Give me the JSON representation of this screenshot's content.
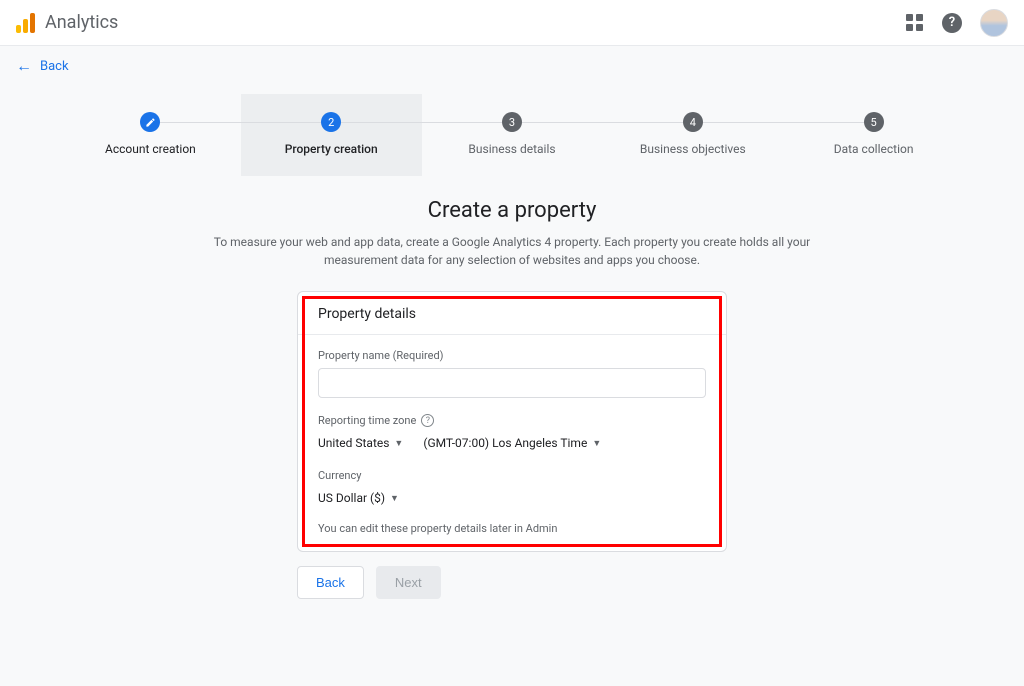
{
  "header": {
    "product_name": "Analytics",
    "back_label": "Back"
  },
  "stepper": {
    "steps": [
      {
        "num": "",
        "label": "Account creation",
        "state": "done",
        "icon": "check"
      },
      {
        "num": "2",
        "label": "Property creation",
        "state": "active"
      },
      {
        "num": "3",
        "label": "Business details",
        "state": "pending"
      },
      {
        "num": "4",
        "label": "Business objectives",
        "state": "pending"
      },
      {
        "num": "5",
        "label": "Data collection",
        "state": "pending"
      }
    ]
  },
  "page": {
    "title": "Create a property",
    "subtitle": "To measure your web and app data, create a Google Analytics 4 property. Each property you create holds all your measurement data for any selection of websites and apps you choose."
  },
  "card": {
    "header": "Property details",
    "property_name_label": "Property name (Required)",
    "property_name_value": "",
    "timezone_label": "Reporting time zone",
    "country_value": "United States",
    "timezone_value": "(GMT-07:00) Los Angeles Time",
    "currency_label": "Currency",
    "currency_value": "US Dollar ($)",
    "hint": "You can edit these property details later in Admin"
  },
  "actions": {
    "back": "Back",
    "next": "Next"
  }
}
